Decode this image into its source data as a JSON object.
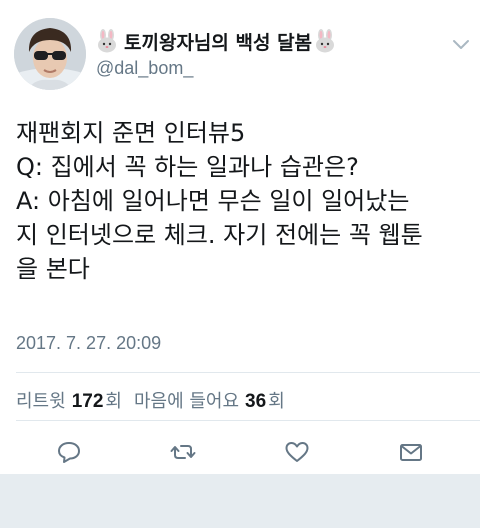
{
  "tweet": {
    "display_name": "토끼왕자님의 백성 달봄",
    "handle": "@dal_bom_",
    "text": "재팬회지 준면 인터뷰5\nQ: 집에서 꼭 하는 일과나 습관은?\nA: 아침에 일어나면 무슨 일이 일어났는\n지 인터넷으로 체크. 자기 전에는 꼭 웹툰\n을 본다",
    "timestamp": "2017. 7. 27. 20:09"
  },
  "stats": {
    "retweets_label": "리트윗",
    "retweets_count": "172",
    "retweets_unit": "회",
    "likes_label": "마음에 들어요",
    "likes_count": "36",
    "likes_unit": "회"
  },
  "icons": {
    "avatar": "user-avatar",
    "name_emoji": "rabbit-face-icon",
    "menu": "chevron-down-icon",
    "reply": "reply-icon",
    "retweet": "retweet-icon",
    "like": "heart-icon",
    "message": "envelope-icon"
  },
  "colors": {
    "text_primary": "#14171a",
    "text_secondary": "#657786",
    "icon": "#657786",
    "divider": "#e1e8ed",
    "background_footer": "#e6ecf0"
  }
}
